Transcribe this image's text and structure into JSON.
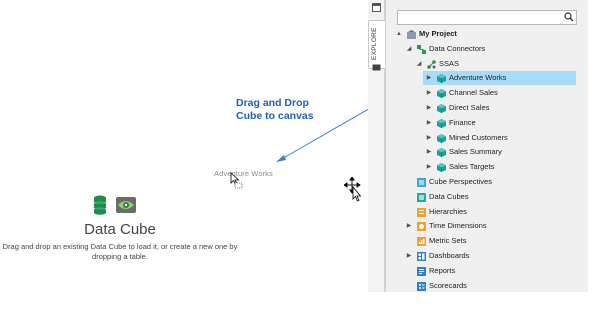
{
  "canvas": {
    "hint": "Drag and Drop\nCube to canvas",
    "hint_line1": "Drag and Drop",
    "hint_line2": "Cube to canvas",
    "drag_ghost": "Adventure Works",
    "placeholder": {
      "title": "Data Cube",
      "description_line1": "Drag and drop an existing Data Cube to load it, or create a new one by",
      "description_line2": "dropping a table."
    }
  },
  "explore_panel": {
    "tab_label": "EXPLORE",
    "search_placeholder": "",
    "tree": [
      {
        "label": "My Project",
        "bold": true,
        "icon": "project-icon",
        "expander": "▲"
      },
      {
        "label": "Data Connectors",
        "icon": "connectors-icon",
        "expander": "◢"
      },
      {
        "label": "SSAS",
        "icon": "ssas-icon",
        "expander": "◢"
      },
      {
        "label": "Adventure Works",
        "icon": "cube-icon",
        "expander": "▶",
        "selected": true
      },
      {
        "label": "Channel Sales",
        "icon": "cube-icon",
        "expander": "▶"
      },
      {
        "label": "Direct Sales",
        "icon": "cube-icon",
        "expander": "▶"
      },
      {
        "label": "Finance",
        "icon": "cube-icon",
        "expander": "▶"
      },
      {
        "label": "Mined Customers",
        "icon": "cube-icon",
        "expander": "▶"
      },
      {
        "label": "Sales Summary",
        "icon": "cube-icon",
        "expander": "▶"
      },
      {
        "label": "Sales Targets",
        "icon": "cube-icon",
        "expander": "▶"
      },
      {
        "label": "Cube Perspectives",
        "icon": "perspectives-icon",
        "expander": ""
      },
      {
        "label": "Data Cubes",
        "icon": "data-cubes-icon",
        "expander": ""
      },
      {
        "label": "Hierarchies",
        "icon": "hierarchies-icon",
        "expander": ""
      },
      {
        "label": "Time Dimensions",
        "icon": "time-dimensions-icon",
        "expander": "▶"
      },
      {
        "label": "Metric Sets",
        "icon": "metric-sets-icon",
        "expander": ""
      },
      {
        "label": "Dashboards",
        "icon": "dashboards-icon",
        "expander": "▶"
      },
      {
        "label": "Reports",
        "icon": "reports-icon",
        "expander": ""
      },
      {
        "label": "Scorecards",
        "icon": "scorecards-icon",
        "expander": ""
      }
    ]
  },
  "colors": {
    "hint_text": "#1f5fb3",
    "selection": "#a7dbf7",
    "cube_teal": "#1aa39a",
    "folder_orange": "#f0a030"
  }
}
